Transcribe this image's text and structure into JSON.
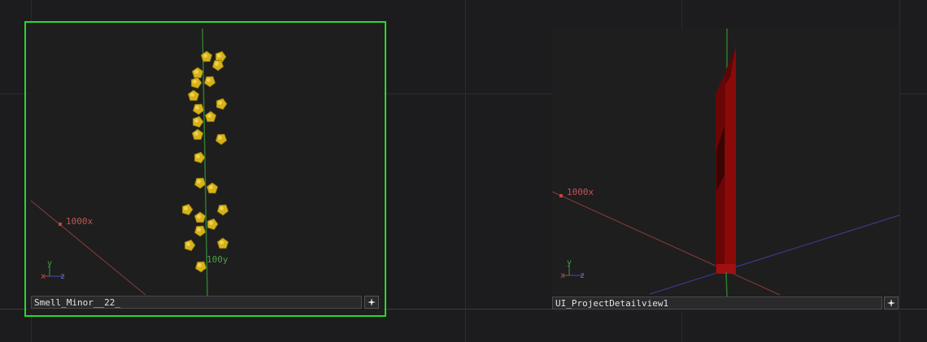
{
  "nodes": [
    {
      "name": "Smell_Minor__22_",
      "selected": true,
      "selection_color": "#2bd72b",
      "axis_labels": {
        "x": "1000x",
        "y": "100y"
      },
      "gizmo": {
        "x": "x",
        "y": "y",
        "z": "z"
      },
      "geometry_color": "#d6b21a"
    },
    {
      "name": "UI_ProjectDetailview1",
      "selected": false,
      "axis_labels": {
        "x": "1000x"
      },
      "gizmo": {
        "x": "x",
        "y": "y",
        "z": "z"
      },
      "geometry_color": "#8a0a0a"
    }
  ],
  "colors": {
    "x_axis": "#b24a4a",
    "y_axis": "#3f9a3f",
    "z_axis": "#4a4ab8",
    "background": "#1c1c1f"
  },
  "icons": {
    "node_add": "plus-icon"
  }
}
